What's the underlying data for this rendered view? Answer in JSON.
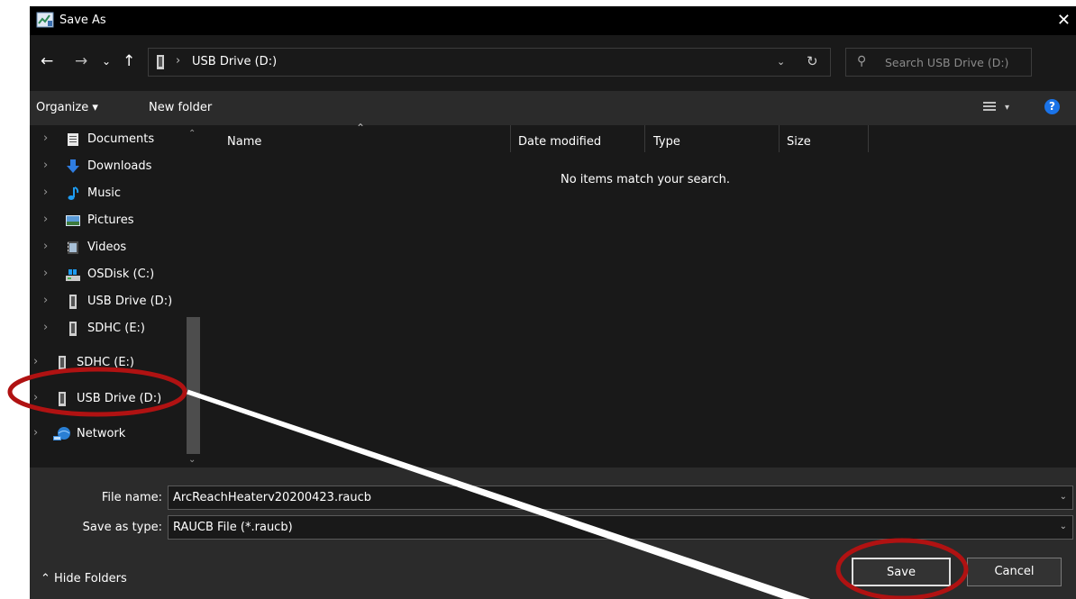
{
  "window": {
    "title": "Save As",
    "close_glyph": "✕"
  },
  "nav": {
    "back_glyph": "←",
    "forward_glyph": "→",
    "recent_glyph": "⌄",
    "up_glyph": "↑"
  },
  "address": {
    "separator": "›",
    "path": "USB Drive (D:)",
    "dropdown_glyph": "⌄",
    "refresh_glyph": "↻"
  },
  "search": {
    "placeholder": "Search USB Drive (D:)",
    "icon": "⚲"
  },
  "toolbar": {
    "organize": "Organize ▾",
    "new_folder": "New folder",
    "view_chev": "▾",
    "help": "?"
  },
  "sidebar": {
    "chevron": "›",
    "items": [
      {
        "label": "Documents",
        "icon": "documents-icon"
      },
      {
        "label": "Downloads",
        "icon": "downloads-icon"
      },
      {
        "label": "Music",
        "icon": "music-icon"
      },
      {
        "label": "Pictures",
        "icon": "pictures-icon"
      },
      {
        "label": "Videos",
        "icon": "videos-icon"
      },
      {
        "label": "OSDisk (C:)",
        "icon": "osdisk-icon"
      },
      {
        "label": "USB Drive (D:)",
        "icon": "usb-drive-icon"
      },
      {
        "label": "SDHC (E:)",
        "icon": "sdhc-icon"
      },
      {
        "label": "SDHC (E:)",
        "icon": "sdhc-icon"
      },
      {
        "label": "USB Drive (D:)",
        "icon": "usb-drive-icon"
      },
      {
        "label": "Network",
        "icon": "network-icon"
      }
    ],
    "scroll_up": "⌃",
    "scroll_down": "⌄"
  },
  "file_list": {
    "columns": [
      "Name",
      "Date modified",
      "Type",
      "Size"
    ],
    "sort_glyph": "⌃",
    "empty_message": "No items match your search."
  },
  "form": {
    "file_name_label": "File name:",
    "file_name_value": "ArcReachHeaterv20200423.raucb",
    "save_type_label": "Save as type:",
    "save_type_value": "RAUCB File (*.raucb)",
    "dropdown_glyph": "⌄"
  },
  "footer": {
    "hide_folders": "⌃  Hide Folders",
    "save": "Save",
    "cancel": "Cancel"
  },
  "colors": {
    "background": "#191919",
    "toolbar": "#2b2b2b",
    "annotation_red": "#b01212",
    "help_blue": "#1a73e8"
  }
}
